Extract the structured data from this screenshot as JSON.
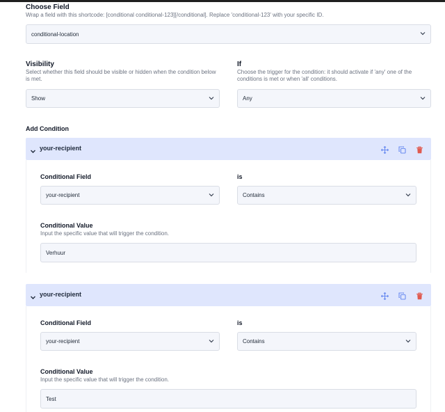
{
  "choose_field": {
    "label": "Choose Field",
    "help": "Wrap a field with this shortcode: [conditional conditional-123][/conditional]. Replace 'conditional-123' with your specific ID.",
    "value": "conditional-location"
  },
  "visibility": {
    "label": "Visibility",
    "help": "Select whether this field should be visible or hidden when the condition below is met.",
    "value": "Show"
  },
  "if_field": {
    "label": "If",
    "help": "Choose the trigger for the condition: it should activate if 'any' one of the conditions is met or when 'all' conditions.",
    "value": "Any"
  },
  "add_condition": {
    "label": "Add Condition"
  },
  "conditions": [
    {
      "title": "your-recipient",
      "field_label": "Conditional Field",
      "field_value": "your-recipient",
      "operator_label": "is",
      "operator_value": "Contains",
      "value_label": "Conditional Value",
      "value_help": "Input the specific value that will trigger the condition.",
      "value": "Verhuur"
    },
    {
      "title": "your-recipient",
      "field_label": "Conditional Field",
      "field_value": "your-recipient",
      "operator_label": "is",
      "operator_value": "Contains",
      "value_label": "Conditional Value",
      "value_help": "Input the specific value that will trigger the condition.",
      "value": "Test"
    }
  ],
  "icons": {
    "toggle": "chevron-down-icon",
    "move": "move-icon",
    "copy": "copy-icon",
    "delete": "trash-icon"
  },
  "colors": {
    "accent": "#6b8cf0",
    "delete": "#e05a4f",
    "header_bg": "#dfe6fd"
  }
}
